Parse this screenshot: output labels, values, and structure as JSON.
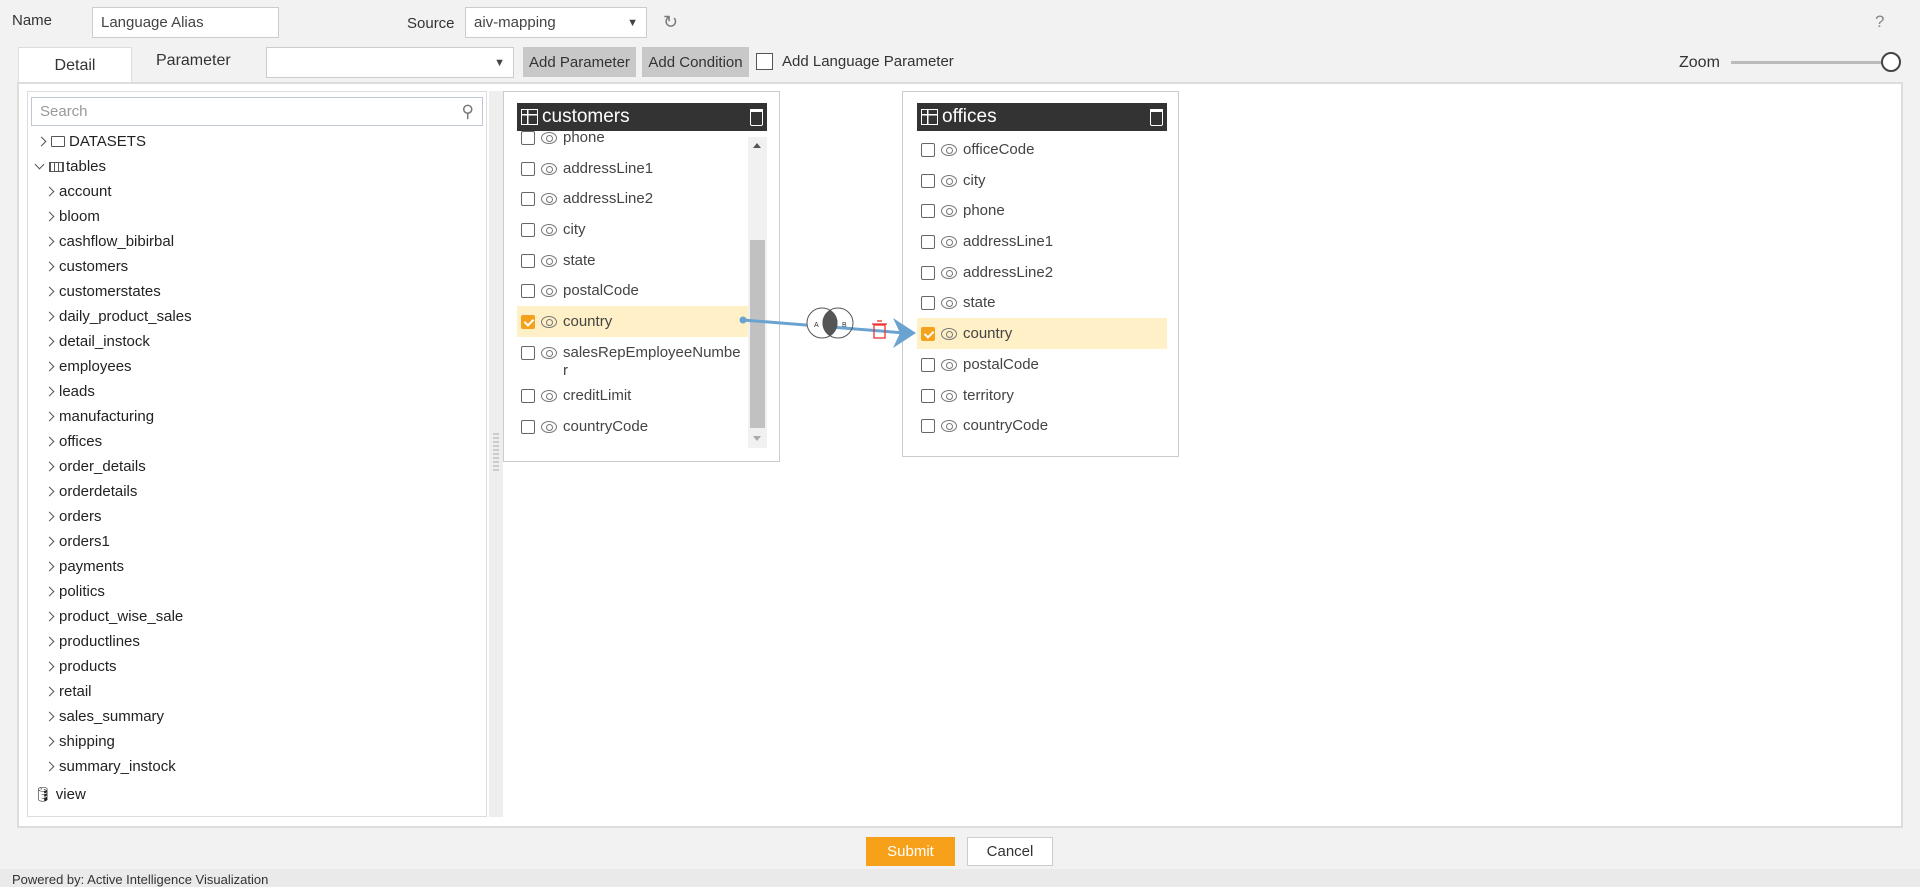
{
  "top": {
    "name_label": "Name",
    "name_value": "Language Alias",
    "source_label": "Source",
    "source_value": "aiv-mapping",
    "help": "?"
  },
  "tabs": {
    "detail": "Detail",
    "parameter": "Parameter",
    "param_select": "",
    "add_parameter": "Add Parameter",
    "add_condition": "Add Condition",
    "add_language_param": "Add Language Parameter",
    "zoom_label": "Zoom",
    "zoom_value": 1.0
  },
  "tree": {
    "search_placeholder": "Search",
    "datasets": "DATASETS",
    "tables": "tables",
    "view": "view",
    "items": [
      "account",
      "bloom",
      "cashflow_bibirbal",
      "customers",
      "customerstates",
      "daily_product_sales",
      "detail_instock",
      "employees",
      "leads",
      "manufacturing",
      "offices",
      "order_details",
      "orderdetails",
      "orders",
      "orders1",
      "payments",
      "politics",
      "product_wise_sale",
      "productlines",
      "products",
      "retail",
      "sales_summary",
      "shipping",
      "summary_instock"
    ]
  },
  "customers": {
    "title": "customers",
    "columns": [
      {
        "name": "phone",
        "checked": false
      },
      {
        "name": "addressLine1",
        "checked": false
      },
      {
        "name": "addressLine2",
        "checked": false
      },
      {
        "name": "city",
        "checked": false
      },
      {
        "name": "state",
        "checked": false
      },
      {
        "name": "postalCode",
        "checked": false
      },
      {
        "name": "country",
        "checked": true
      },
      {
        "name": "salesRepEmployeeNumber",
        "checked": false
      },
      {
        "name": "creditLimit",
        "checked": false
      },
      {
        "name": "countryCode",
        "checked": false
      }
    ]
  },
  "offices": {
    "title": "offices",
    "columns": [
      {
        "name": "officeCode",
        "checked": false
      },
      {
        "name": "city",
        "checked": false
      },
      {
        "name": "phone",
        "checked": false
      },
      {
        "name": "addressLine1",
        "checked": false
      },
      {
        "name": "addressLine2",
        "checked": false
      },
      {
        "name": "state",
        "checked": false
      },
      {
        "name": "country",
        "checked": true
      },
      {
        "name": "postalCode",
        "checked": false
      },
      {
        "name": "territory",
        "checked": false
      },
      {
        "name": "countryCode",
        "checked": false
      }
    ]
  },
  "join": {
    "type": "inner",
    "left_label": "A",
    "right_label": "B",
    "line_color": "#6aa3d0"
  },
  "footer": {
    "submit": "Submit",
    "cancel": "Cancel",
    "powered_by": "Powered by: Active Intelligence Visualization"
  },
  "colors": {
    "accent": "#f7a11a",
    "header": "#333333"
  }
}
